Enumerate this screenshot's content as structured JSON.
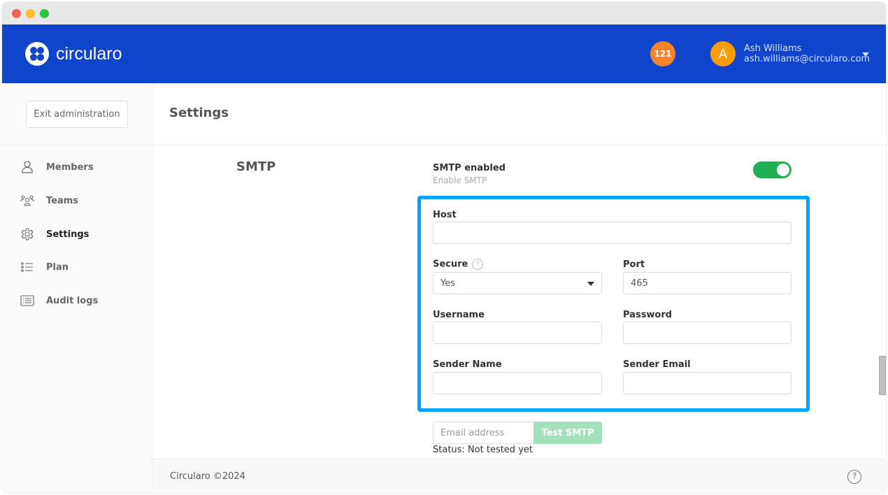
{
  "header": {
    "brand": "circularo",
    "notifications_count": "121",
    "user": {
      "initial": "A",
      "name": "Ash Williams",
      "email": "ash.williams@circularo.com"
    },
    "brand_color": "#0f44cc"
  },
  "sidebar": {
    "exit_label": "Exit administration",
    "items": [
      {
        "label": "Members",
        "icon": "user-icon"
      },
      {
        "label": "Teams",
        "icon": "users-icon"
      },
      {
        "label": "Settings",
        "icon": "gear-icon",
        "active": true
      },
      {
        "label": "Plan",
        "icon": "list-icon"
      },
      {
        "label": "Audit logs",
        "icon": "log-icon"
      }
    ]
  },
  "main": {
    "title": "Settings",
    "section": "SMTP",
    "smtp_enabled": {
      "label": "SMTP enabled",
      "sub": "Enable SMTP",
      "value": true
    },
    "fields": {
      "host": {
        "label": "Host",
        "value": ""
      },
      "secure": {
        "label": "Secure",
        "value": "Yes"
      },
      "port": {
        "label": "Port",
        "value": "465"
      },
      "username": {
        "label": "Username",
        "value": ""
      },
      "password": {
        "label": "Password",
        "value": ""
      },
      "sender_name": {
        "label": "Sender Name",
        "value": ""
      },
      "sender_email": {
        "label": "Sender Email",
        "value": ""
      }
    },
    "test": {
      "placeholder": "Email address",
      "button": "Test SMTP",
      "status": "Status: Not tested yet"
    }
  },
  "footer": {
    "copyright": "Circularo ©2024"
  }
}
